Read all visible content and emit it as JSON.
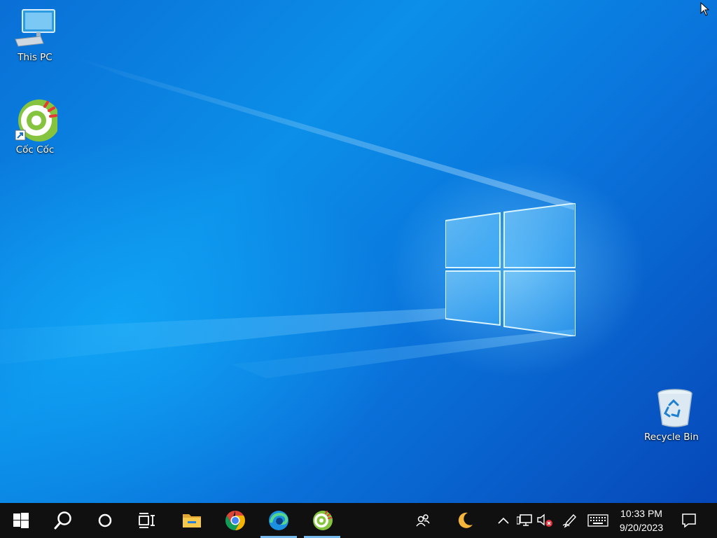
{
  "desktop": {
    "icons": [
      {
        "label": "This PC",
        "icon": "this-pc-icon"
      },
      {
        "label": "Cốc Cốc",
        "icon": "coccoc-icon"
      },
      {
        "label": "Recycle Bin",
        "icon": "recycle-bin-icon"
      }
    ],
    "wallpaper": "windows-10-hero",
    "colors": {
      "accent": "#0a78dc",
      "taskbar": "#101010",
      "active_indicator": "#76b9ed"
    }
  },
  "taskbar": {
    "start": "windows-logo-icon",
    "search": "search-icon",
    "cortana": "cortana-circle-icon",
    "task_view": "task-view-icon",
    "apps": [
      {
        "name": "File Explorer",
        "icon": "file-explorer-icon",
        "active": false
      },
      {
        "name": "Google Chrome",
        "icon": "chrome-icon",
        "active": false
      },
      {
        "name": "Microsoft Edge",
        "icon": "edge-icon",
        "active": true
      },
      {
        "name": "Cốc Cốc",
        "icon": "coccoc-icon",
        "active": true
      }
    ],
    "tray": {
      "people": "people-icon",
      "weather": "moon-icon",
      "overflow": "chevron-up-icon",
      "network": "network-icon",
      "volume": "volume-muted-icon",
      "pen": "pen-workspace-icon",
      "keyboard": "touch-keyboard-icon",
      "notifications": "action-center-icon"
    },
    "clock": {
      "time": "10:33 PM",
      "date": "9/20/2023"
    }
  }
}
